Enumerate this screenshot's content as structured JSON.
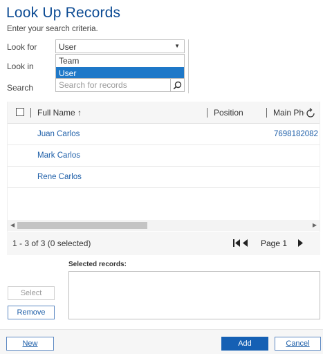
{
  "dialog": {
    "title": "Look Up Records",
    "subtitle": "Enter your search criteria."
  },
  "form": {
    "look_for_label": "Look for",
    "look_in_label": "Look in",
    "search_label": "Search",
    "look_for_value": "User",
    "look_for_options": [
      "Team",
      "User"
    ],
    "look_for_selected_option": "User",
    "search_placeholder": "Search for records",
    "search_value": ""
  },
  "grid": {
    "columns": [
      "Full Name ↑",
      "Position",
      "Main Pho"
    ],
    "rows": [
      {
        "full_name": "Juan Carlos",
        "position": "",
        "main_phone": "7698182082"
      },
      {
        "full_name": "Mark Carlos",
        "position": "",
        "main_phone": ""
      },
      {
        "full_name": "Rene Carlos",
        "position": "",
        "main_phone": ""
      }
    ]
  },
  "pager": {
    "count_text": "1 - 3 of 3 (0 selected)",
    "page_text": "Page 1"
  },
  "selected": {
    "label": "Selected records:",
    "select_button": "Select",
    "remove_button": "Remove"
  },
  "footer": {
    "new_button": "New",
    "add_button": "Add",
    "cancel_button": "Cancel"
  },
  "colors": {
    "title": "#0b4a93",
    "link": "#1d5ea8",
    "primary_button": "#1560b4",
    "dropdown_selected": "#1e78c8"
  },
  "icons": {
    "dropdown_caret": "caret-down-icon",
    "search": "search-icon",
    "refresh": "refresh-icon",
    "first_page": "first-page-icon",
    "previous_page": "previous-page-icon",
    "next_page": "next-page-icon"
  }
}
